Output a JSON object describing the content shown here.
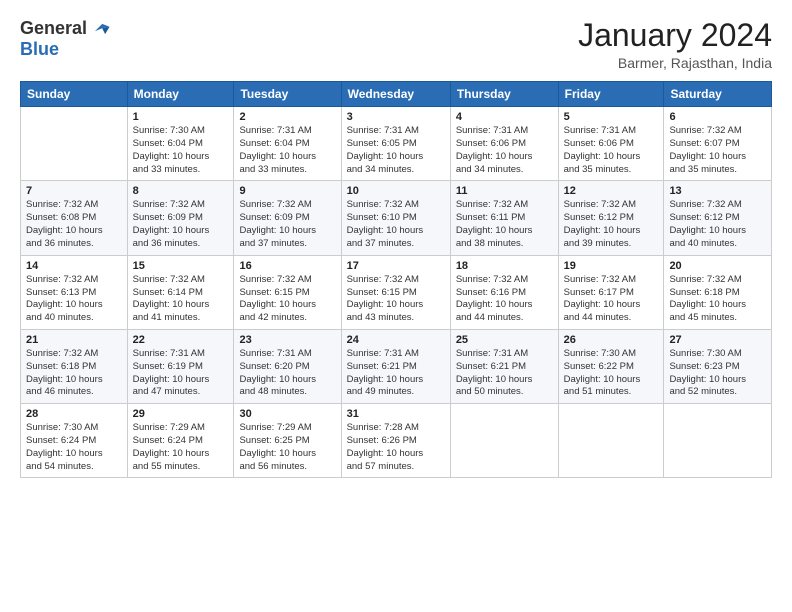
{
  "header": {
    "logo_line1": "General",
    "logo_line2": "Blue",
    "month": "January 2024",
    "location": "Barmer, Rajasthan, India"
  },
  "weekdays": [
    "Sunday",
    "Monday",
    "Tuesday",
    "Wednesday",
    "Thursday",
    "Friday",
    "Saturday"
  ],
  "weeks": [
    [
      {
        "day": "",
        "info": ""
      },
      {
        "day": "1",
        "info": "Sunrise: 7:30 AM\nSunset: 6:04 PM\nDaylight: 10 hours\nand 33 minutes."
      },
      {
        "day": "2",
        "info": "Sunrise: 7:31 AM\nSunset: 6:04 PM\nDaylight: 10 hours\nand 33 minutes."
      },
      {
        "day": "3",
        "info": "Sunrise: 7:31 AM\nSunset: 6:05 PM\nDaylight: 10 hours\nand 34 minutes."
      },
      {
        "day": "4",
        "info": "Sunrise: 7:31 AM\nSunset: 6:06 PM\nDaylight: 10 hours\nand 34 minutes."
      },
      {
        "day": "5",
        "info": "Sunrise: 7:31 AM\nSunset: 6:06 PM\nDaylight: 10 hours\nand 35 minutes."
      },
      {
        "day": "6",
        "info": "Sunrise: 7:32 AM\nSunset: 6:07 PM\nDaylight: 10 hours\nand 35 minutes."
      }
    ],
    [
      {
        "day": "7",
        "info": "Sunrise: 7:32 AM\nSunset: 6:08 PM\nDaylight: 10 hours\nand 36 minutes."
      },
      {
        "day": "8",
        "info": "Sunrise: 7:32 AM\nSunset: 6:09 PM\nDaylight: 10 hours\nand 36 minutes."
      },
      {
        "day": "9",
        "info": "Sunrise: 7:32 AM\nSunset: 6:09 PM\nDaylight: 10 hours\nand 37 minutes."
      },
      {
        "day": "10",
        "info": "Sunrise: 7:32 AM\nSunset: 6:10 PM\nDaylight: 10 hours\nand 37 minutes."
      },
      {
        "day": "11",
        "info": "Sunrise: 7:32 AM\nSunset: 6:11 PM\nDaylight: 10 hours\nand 38 minutes."
      },
      {
        "day": "12",
        "info": "Sunrise: 7:32 AM\nSunset: 6:12 PM\nDaylight: 10 hours\nand 39 minutes."
      },
      {
        "day": "13",
        "info": "Sunrise: 7:32 AM\nSunset: 6:12 PM\nDaylight: 10 hours\nand 40 minutes."
      }
    ],
    [
      {
        "day": "14",
        "info": "Sunrise: 7:32 AM\nSunset: 6:13 PM\nDaylight: 10 hours\nand 40 minutes."
      },
      {
        "day": "15",
        "info": "Sunrise: 7:32 AM\nSunset: 6:14 PM\nDaylight: 10 hours\nand 41 minutes."
      },
      {
        "day": "16",
        "info": "Sunrise: 7:32 AM\nSunset: 6:15 PM\nDaylight: 10 hours\nand 42 minutes."
      },
      {
        "day": "17",
        "info": "Sunrise: 7:32 AM\nSunset: 6:15 PM\nDaylight: 10 hours\nand 43 minutes."
      },
      {
        "day": "18",
        "info": "Sunrise: 7:32 AM\nSunset: 6:16 PM\nDaylight: 10 hours\nand 44 minutes."
      },
      {
        "day": "19",
        "info": "Sunrise: 7:32 AM\nSunset: 6:17 PM\nDaylight: 10 hours\nand 44 minutes."
      },
      {
        "day": "20",
        "info": "Sunrise: 7:32 AM\nSunset: 6:18 PM\nDaylight: 10 hours\nand 45 minutes."
      }
    ],
    [
      {
        "day": "21",
        "info": "Sunrise: 7:32 AM\nSunset: 6:18 PM\nDaylight: 10 hours\nand 46 minutes."
      },
      {
        "day": "22",
        "info": "Sunrise: 7:31 AM\nSunset: 6:19 PM\nDaylight: 10 hours\nand 47 minutes."
      },
      {
        "day": "23",
        "info": "Sunrise: 7:31 AM\nSunset: 6:20 PM\nDaylight: 10 hours\nand 48 minutes."
      },
      {
        "day": "24",
        "info": "Sunrise: 7:31 AM\nSunset: 6:21 PM\nDaylight: 10 hours\nand 49 minutes."
      },
      {
        "day": "25",
        "info": "Sunrise: 7:31 AM\nSunset: 6:21 PM\nDaylight: 10 hours\nand 50 minutes."
      },
      {
        "day": "26",
        "info": "Sunrise: 7:30 AM\nSunset: 6:22 PM\nDaylight: 10 hours\nand 51 minutes."
      },
      {
        "day": "27",
        "info": "Sunrise: 7:30 AM\nSunset: 6:23 PM\nDaylight: 10 hours\nand 52 minutes."
      }
    ],
    [
      {
        "day": "28",
        "info": "Sunrise: 7:30 AM\nSunset: 6:24 PM\nDaylight: 10 hours\nand 54 minutes."
      },
      {
        "day": "29",
        "info": "Sunrise: 7:29 AM\nSunset: 6:24 PM\nDaylight: 10 hours\nand 55 minutes."
      },
      {
        "day": "30",
        "info": "Sunrise: 7:29 AM\nSunset: 6:25 PM\nDaylight: 10 hours\nand 56 minutes."
      },
      {
        "day": "31",
        "info": "Sunrise: 7:28 AM\nSunset: 6:26 PM\nDaylight: 10 hours\nand 57 minutes."
      },
      {
        "day": "",
        "info": ""
      },
      {
        "day": "",
        "info": ""
      },
      {
        "day": "",
        "info": ""
      }
    ]
  ]
}
